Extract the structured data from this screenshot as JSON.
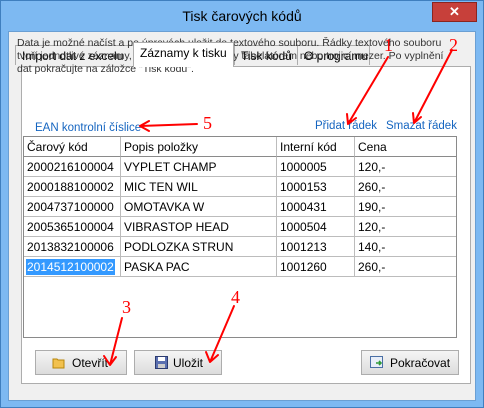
{
  "window": {
    "title": "Tisk čarových kódů",
    "close_label": "✕"
  },
  "tabs": [
    {
      "label": "Import dat z excelu"
    },
    {
      "label": "Záznamy k tisku"
    },
    {
      "label": "Tisk kódů"
    },
    {
      "label": "O programu"
    }
  ],
  "description": "Data je možné  načíst a po úpravách  uložit do  textového souboru.  Řádky textového souboru tvoří jednotlivé záznamy, sloupce jsou odděleny tabelátorem nebo trojicí mezer. Po vyplnění dat pokračujte na záložce \"Tisk kódů\".",
  "links": {
    "ean": "EAN kontrolní číslice",
    "add_row": "Přidat řádek",
    "delete_row": "Smazat řádek"
  },
  "table": {
    "columns": [
      "Čarový kód",
      "Popis položky",
      "Interní kód",
      "Cena"
    ],
    "rows": [
      [
        "2000216100004",
        "VYPLET CHAMP",
        "1000005",
        "120,-"
      ],
      [
        "2000188100002",
        "MIC TEN WIL",
        "1000153",
        "260,-"
      ],
      [
        "2004737100000",
        "OMOTAVKA W",
        "1000431",
        "190,-"
      ],
      [
        "2005365100004",
        "VIBRASTOP HEAD",
        "1000504",
        "120,-"
      ],
      [
        "2013832100006",
        "PODLOZKA STRUN",
        "1001213",
        "140,-"
      ],
      [
        "2014512100002",
        "PASKA PAC",
        "1001260",
        "260,-"
      ]
    ]
  },
  "buttons": {
    "open": "Otevřít",
    "save": "Uložit",
    "continue": "Pokračovat"
  },
  "annotations": {
    "n1": "1",
    "n2": "2",
    "n3": "3",
    "n4": "4",
    "n5": "5",
    "color": "#ff0000"
  }
}
